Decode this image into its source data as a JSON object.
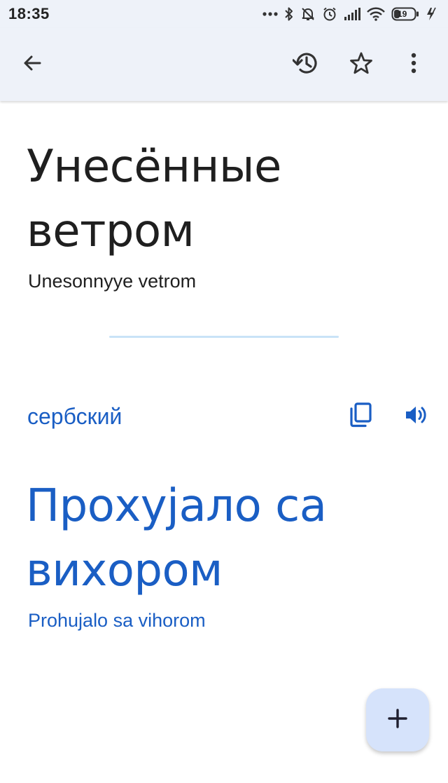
{
  "status_bar": {
    "time": "18:35",
    "battery_level": "19",
    "icons": [
      "more-dots-icon",
      "bluetooth-icon",
      "muted-bell-icon",
      "alarm-icon",
      "signal-icon",
      "wifi-icon",
      "battery-icon",
      "charging-icon"
    ]
  },
  "app_bar": {
    "icons": [
      "back-arrow-icon",
      "history-icon",
      "star-icon",
      "more-vert-icon"
    ]
  },
  "source": {
    "text": "Унесённые ветром",
    "transliteration": "Unesonnyye vetrom"
  },
  "target": {
    "language": "сербский",
    "text": "Прохујало са вихором",
    "transliteration": "Prohujalo sa vihorom",
    "icons": [
      "copy-icon",
      "speaker-icon"
    ]
  },
  "fab": {
    "icon": "plus-icon"
  },
  "colors": {
    "accent_blue": "#1a5ec4",
    "appbar_bg": "#eef2f9",
    "fab_bg": "#d6e3fb",
    "divider": "#c9e3f7"
  }
}
